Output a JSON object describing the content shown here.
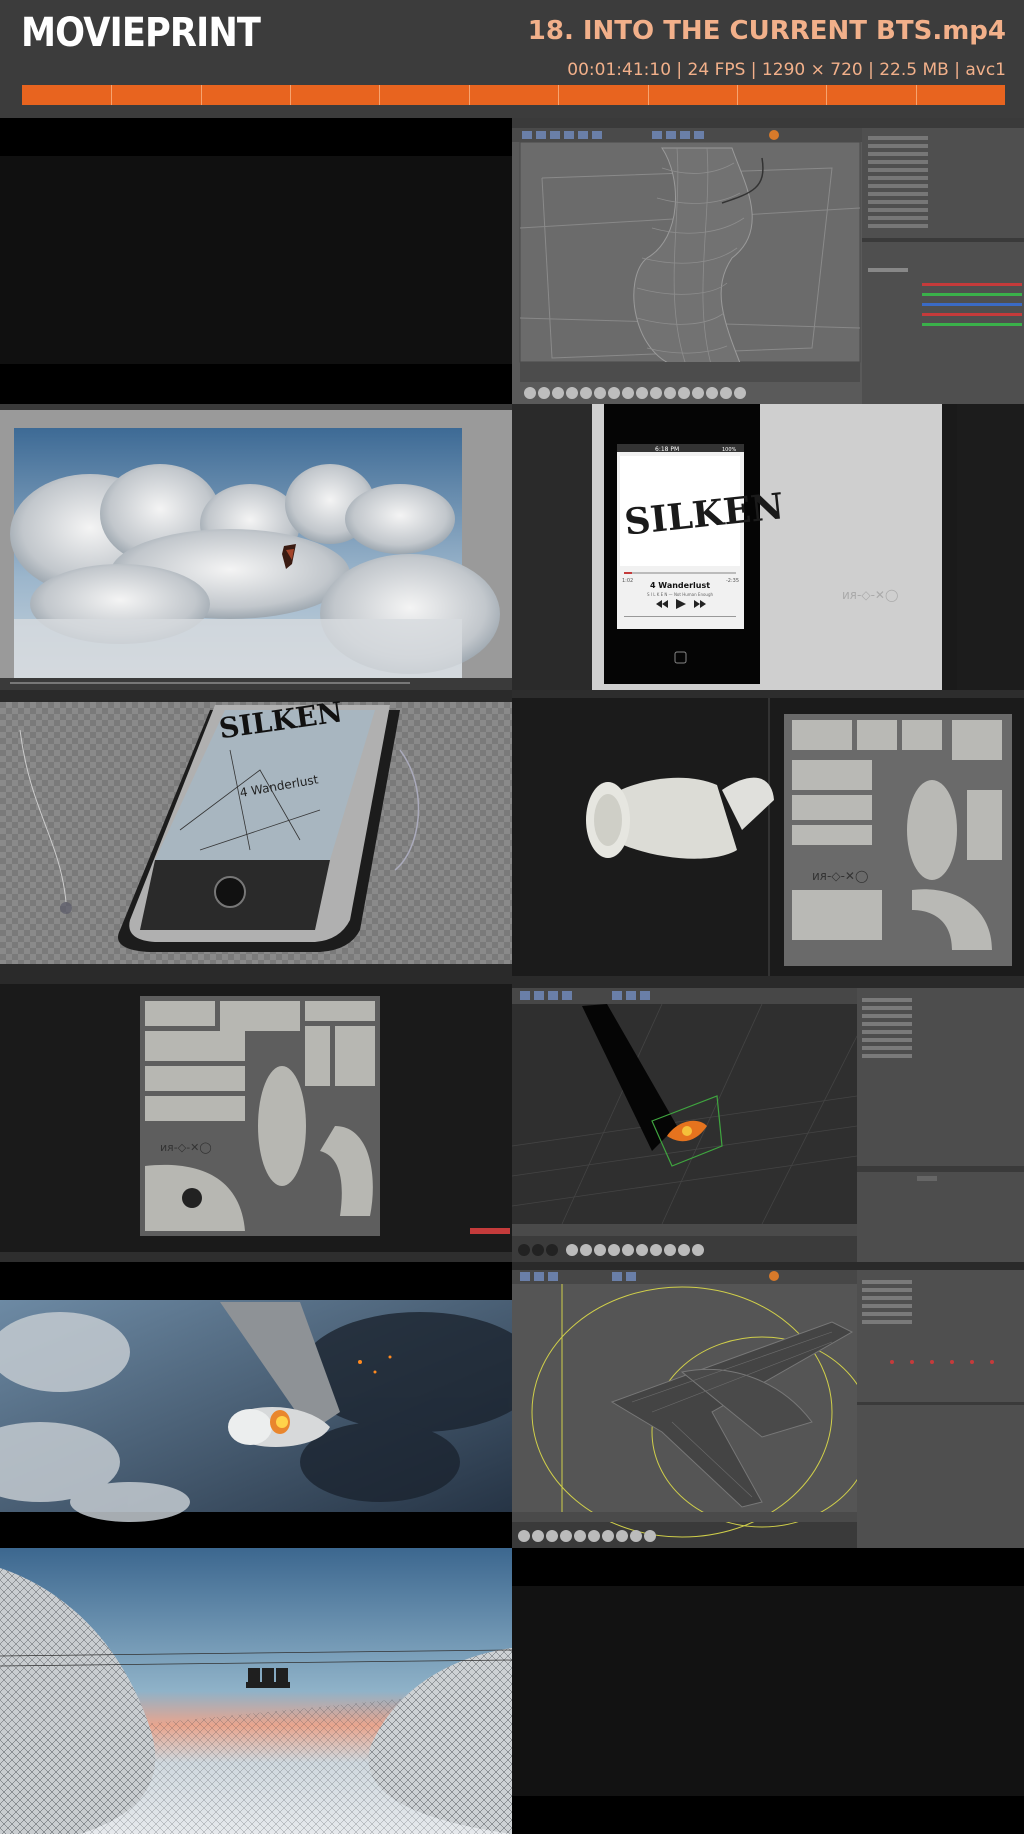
{
  "app": {
    "logo": "MOVIEPRINT",
    "file_title": "18. INTO THE CURRENT BTS.mp4",
    "meta": "00:01:41:10 | 24 FPS | 1290 × 720 | 22.5 MB | avc1"
  },
  "colors": {
    "header_bg": "#3c3c3c",
    "accent_orange": "#e8641f",
    "title_text": "#f2b08a"
  },
  "timeline": {
    "segments": 11
  },
  "thumbnails": [
    {
      "label": "frame-1-black"
    },
    {
      "label": "frame-2-cinema4d-wireframe-hand"
    },
    {
      "label": "frame-3-clouds-render"
    },
    {
      "label": "frame-4-phone-player"
    },
    {
      "label": "frame-5-broken-phone-render"
    },
    {
      "label": "frame-6-engine-uv-texture"
    },
    {
      "label": "frame-7-uv-texture-map"
    },
    {
      "label": "frame-8-burning-wing-viewport"
    },
    {
      "label": "frame-9-burning-engine-render"
    },
    {
      "label": "frame-10-airplane-wireframe"
    },
    {
      "label": "frame-11-seats-clouds-wireframe"
    },
    {
      "label": "frame-12-black"
    }
  ],
  "phone": {
    "time": "6:18 PM",
    "battery": "100%",
    "band": "SILKEN",
    "song": "4 Wanderlust",
    "artist": "S I L K E N — Not Human Enough",
    "elapsed": "1:02",
    "remaining": "-2:35"
  },
  "texture_text": "ᴎᴙ-◇-✕◯",
  "page_footer": ""
}
